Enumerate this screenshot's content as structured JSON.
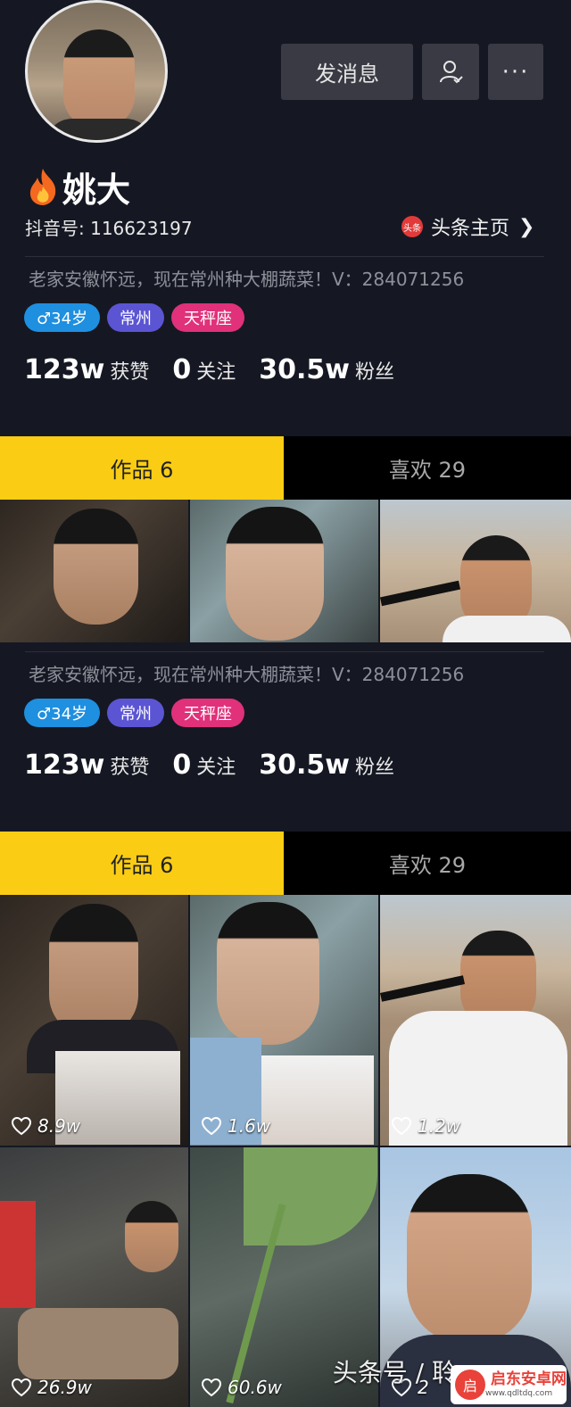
{
  "profile": {
    "name": "姚大",
    "douyin_id": "抖音号: 116623197",
    "toutiao_badge": "头条",
    "toutiao_link": "头条主页",
    "bio": "老家安徽怀远，现在常州种大棚蔬菜！V：284071256",
    "tags": {
      "age": "♂34岁",
      "city": "常州",
      "zodiac": "天秤座"
    },
    "stats": {
      "likes_num": "123w",
      "likes_label": "获赞",
      "following_num": "0",
      "following_label": "关注",
      "fans_num": "30.5w",
      "fans_label": "粉丝"
    }
  },
  "actions": {
    "message": "发消息",
    "follow_icon": "user-follow-icon",
    "more": "···"
  },
  "tabs": {
    "works": "作品 6",
    "likes": "喜欢 29"
  },
  "videos": [
    {
      "likes": "8.9w"
    },
    {
      "likes": "1.6w"
    },
    {
      "likes": "1.2w"
    },
    {
      "likes": "26.9w"
    },
    {
      "likes": "60.6w"
    },
    {
      "likes": "2"
    }
  ],
  "watermark": "头条号 / 聆",
  "site_logo": {
    "mark": "启",
    "name": "启东安卓网",
    "url": "www.qdltdq.com"
  },
  "colors": {
    "accent_yellow": "#facd14",
    "tag_blue": "#1f8fe0",
    "tag_purple": "#5b55d3",
    "tag_pink": "#e0317a",
    "bg": "#151823"
  }
}
